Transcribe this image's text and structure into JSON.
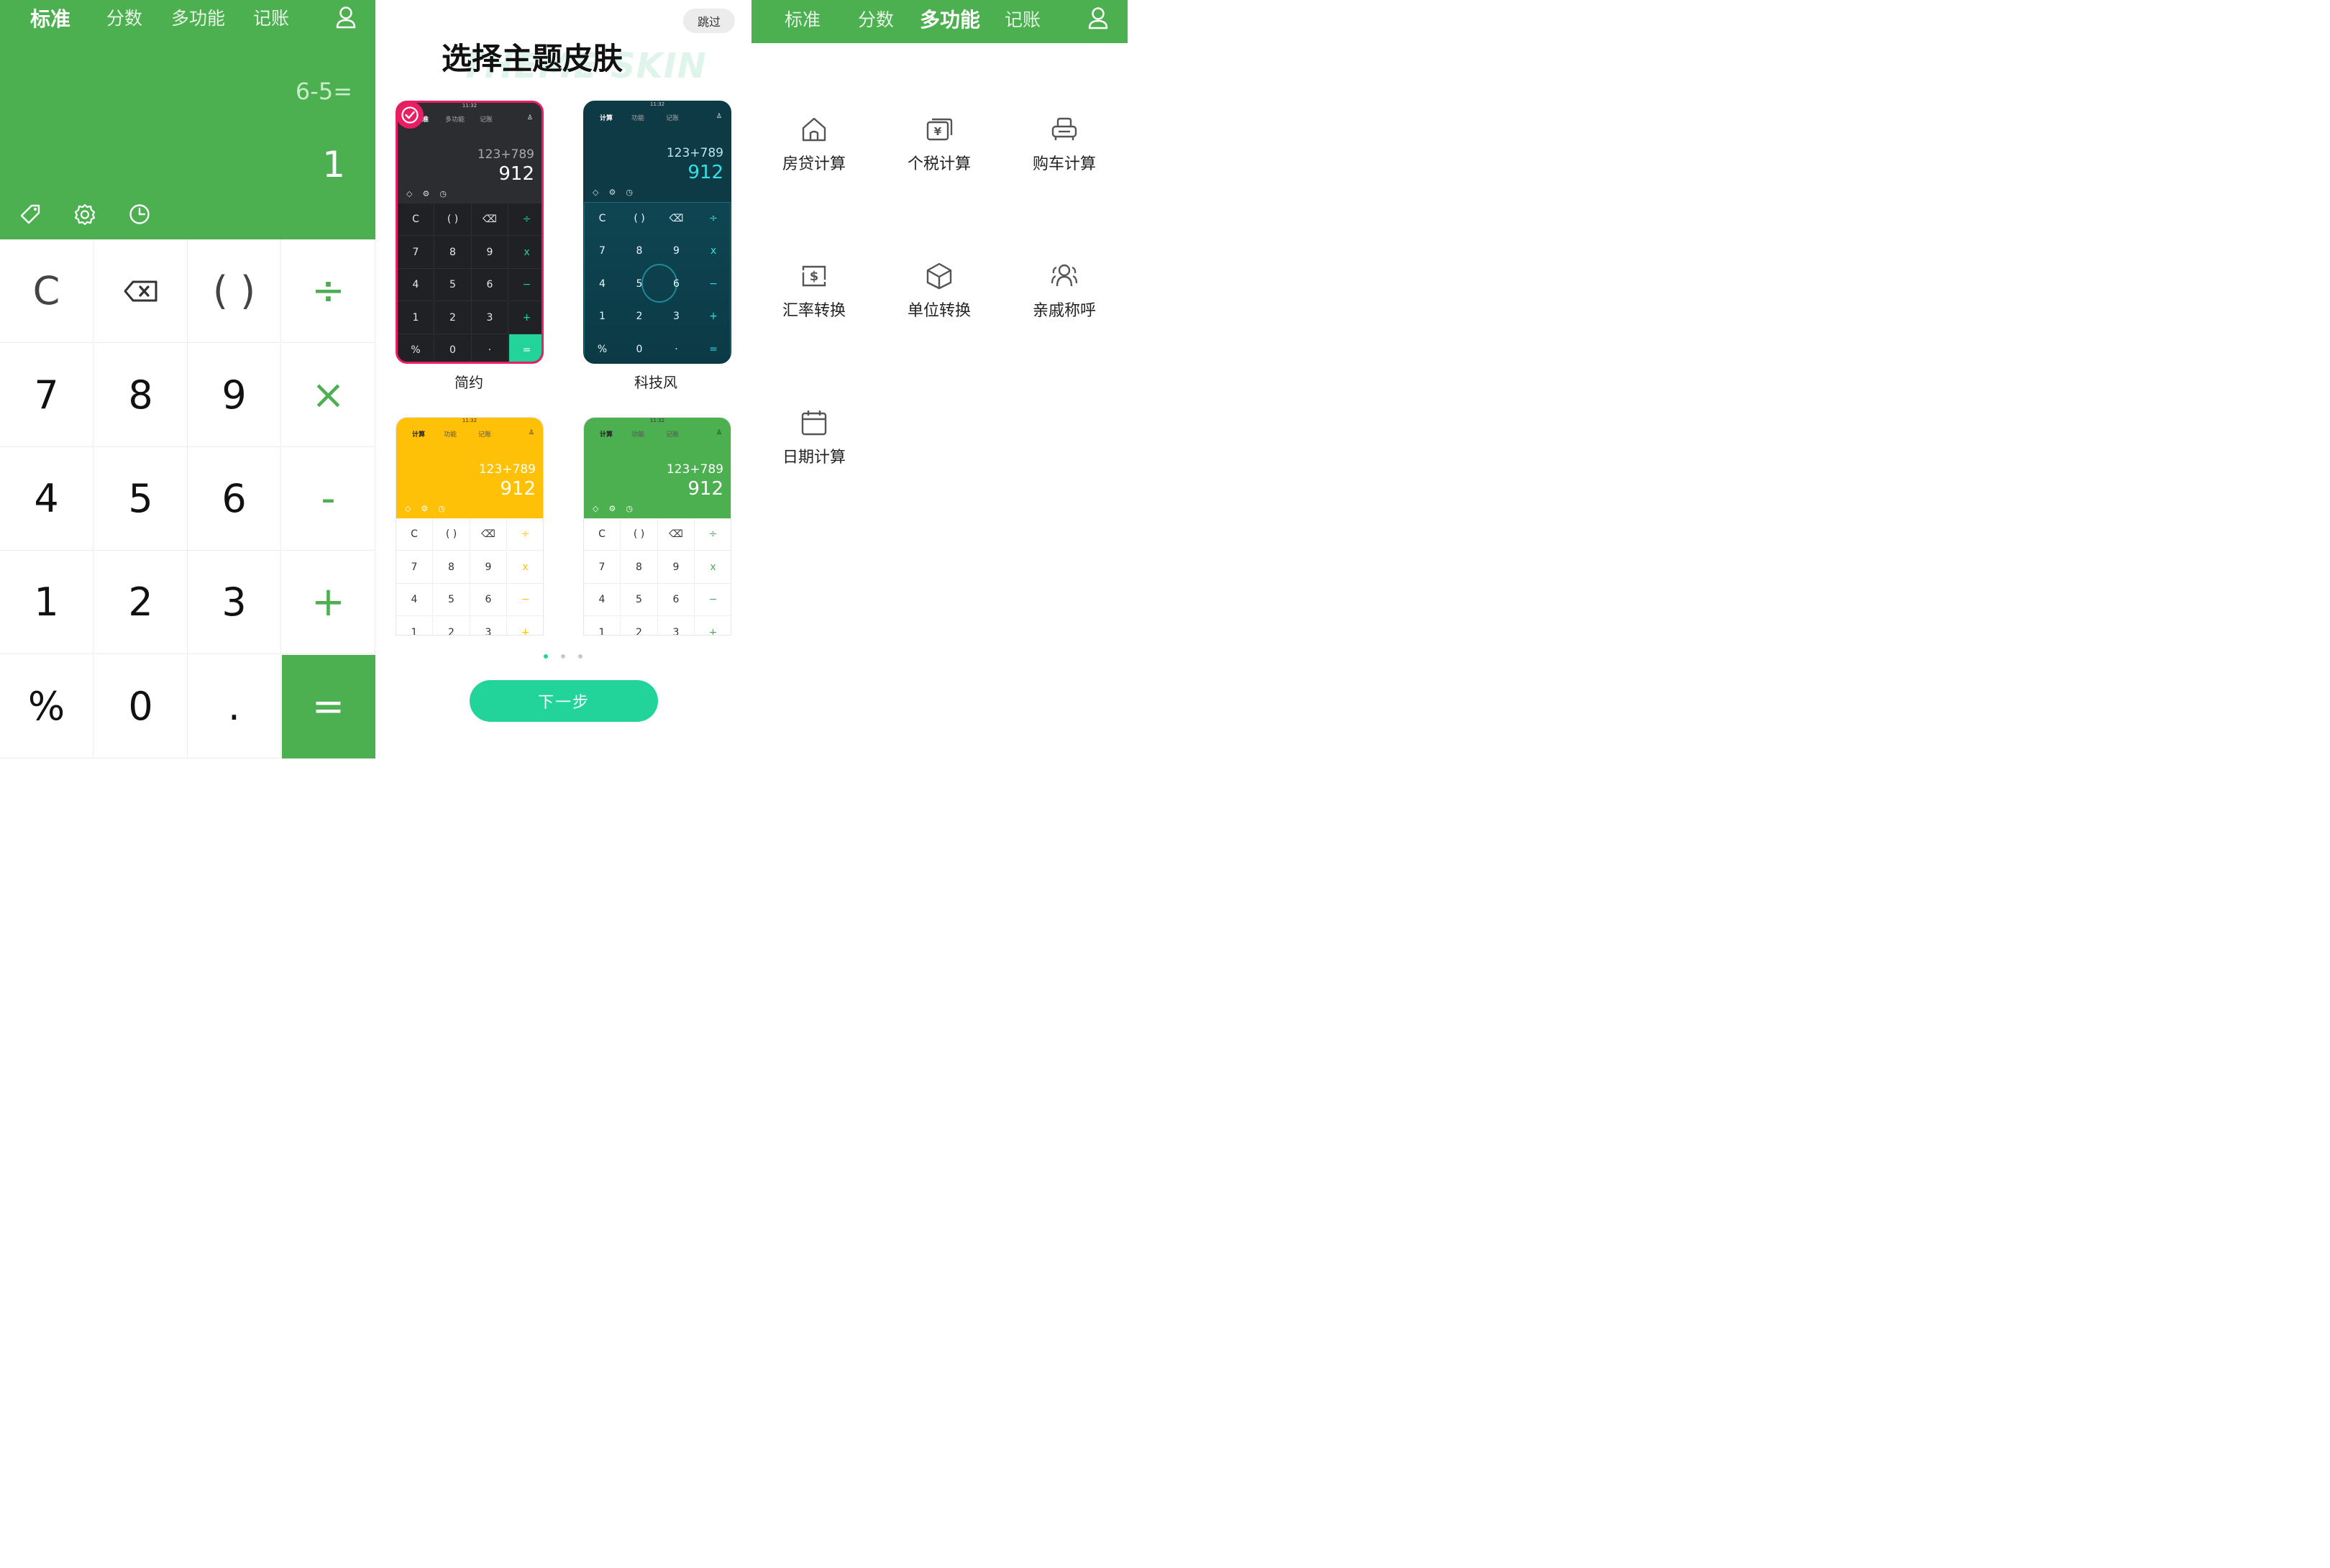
{
  "left": {
    "tabs": [
      "标准",
      "分数",
      "多功能",
      "记账"
    ],
    "active_tab": "标准",
    "expression": "6-5=",
    "result": "1",
    "tool_icons": [
      "tag-icon",
      "settings-icon",
      "history-icon"
    ],
    "keys": [
      [
        "C",
        "⌫",
        "( )",
        "÷"
      ],
      [
        "7",
        "8",
        "9",
        "×"
      ],
      [
        "4",
        "5",
        "6",
        "-"
      ],
      [
        "1",
        "2",
        "3",
        "+"
      ],
      [
        "%",
        "0",
        ".",
        "="
      ]
    ],
    "colors": {
      "primary": "#4caf50",
      "text": "#111111"
    }
  },
  "middle": {
    "skip": "跳过",
    "title": "选择主题皮肤",
    "watermark": "THEME SKIN",
    "themes": [
      {
        "label": "简约",
        "selected": true,
        "time": "11:32",
        "tabs": [
          "准",
          "多功能",
          "记账"
        ],
        "expr": "123+789",
        "res": "912",
        "colors": {
          "bg": "#2b2d31",
          "keys": "#1f2124",
          "text": "#e8e8e8",
          "accent": "#22d39a",
          "border": "#e91e63"
        }
      },
      {
        "label": "科技风",
        "selected": false,
        "time": "11:32",
        "tabs": [
          "计算",
          "功能",
          "记账"
        ],
        "expr": "123+789",
        "res": "912",
        "colors": {
          "bg": "#0d3a45",
          "keys": "#0f4552",
          "text": "#e8f8ff",
          "accent": "#35e0e6",
          "border": "#0d3a45"
        }
      },
      {
        "label": "",
        "selected": false,
        "time": "11:32",
        "tabs": [
          "计算",
          "功能",
          "记账"
        ],
        "expr": "123+789",
        "res": "912",
        "colors": {
          "bg": "#ffc107",
          "keys": "#ffffff",
          "text": "#333333",
          "accent": "#ffc107",
          "border": "#e6e6e6"
        }
      },
      {
        "label": "",
        "selected": false,
        "time": "11:32",
        "tabs": [
          "计算",
          "功能",
          "记账"
        ],
        "expr": "123+789",
        "res": "912",
        "colors": {
          "bg": "#4caf50",
          "keys": "#ffffff",
          "text": "#333333",
          "accent": "#4caf50",
          "border": "#e6e6e6"
        }
      }
    ],
    "mini_keys": [
      [
        "C",
        "( )",
        "⌫",
        "÷"
      ],
      [
        "7",
        "8",
        "9",
        "x"
      ],
      [
        "4",
        "5",
        "6",
        "−"
      ],
      [
        "1",
        "2",
        "3",
        "+"
      ],
      [
        "%",
        "0",
        "·",
        "="
      ]
    ],
    "page_dots": 3,
    "active_dot": 0,
    "next": "下一步",
    "colors": {
      "button": "#22d39a",
      "selected_border": "#e91e63"
    }
  },
  "right": {
    "tabs": [
      "标准",
      "分数",
      "多功能",
      "记账"
    ],
    "active_tab": "多功能",
    "functions": [
      {
        "label": "房贷计算",
        "icon": "house-icon"
      },
      {
        "label": "个税计算",
        "icon": "money-card-icon"
      },
      {
        "label": "购车计算",
        "icon": "car-icon"
      },
      {
        "label": "汇率转换",
        "icon": "exchange-icon"
      },
      {
        "label": "单位转换",
        "icon": "cube-icon"
      },
      {
        "label": "亲戚称呼",
        "icon": "people-icon"
      },
      {
        "label": "日期计算",
        "icon": "calendar-icon"
      }
    ]
  }
}
